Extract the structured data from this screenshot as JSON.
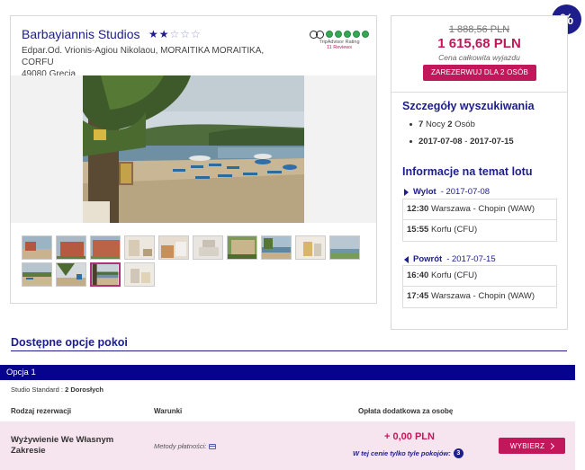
{
  "hotel": {
    "name": "Barbayiannis Studios",
    "stars_full": "★★",
    "stars_empty": "☆☆☆",
    "address_line1": "Edpar.Od. Vrionis-Agiou Nikolaou, MORAITIKA MORAITIKA, CORFU",
    "address_line2": "49080 Grecja",
    "tripadvisor": {
      "label": "TripAdvisor Rating",
      "reviews": "11 Reviews",
      "rating_of_5": 5
    }
  },
  "price": {
    "old": "1 888,56 PLN",
    "new": "1 615,68 PLN",
    "note": "Cena całkowita wyjazdu",
    "book_label": "ZAREZERWUJ DLA 2 OSÓB"
  },
  "badge": "%",
  "search_details": {
    "title": "Szczegóły wyszukiwania",
    "nights": "7",
    "nights_label": "Nocy",
    "persons": "2",
    "persons_label": "Osób",
    "date_from": "2017-07-08",
    "date_sep": "-",
    "date_to": "2017-07-15"
  },
  "flight": {
    "title": "Informacje na temat lotu",
    "outbound": {
      "label": "Wylot",
      "date": "- 2017-07-08",
      "legs": [
        {
          "time": "12:30",
          "place": "Warszawa - Chopin (WAW)"
        },
        {
          "time": "15:55",
          "place": "Korfu (CFU)"
        }
      ]
    },
    "return": {
      "label": "Powrót",
      "date": "- 2017-07-15",
      "legs": [
        {
          "time": "16:40",
          "place": "Korfu (CFU)"
        },
        {
          "time": "17:45",
          "place": "Warszawa - Chopin (WAW)"
        }
      ]
    }
  },
  "rooms": {
    "title": "Dostępne opcje pokoi",
    "option_label": "Opcja 1",
    "room_type": "Studio Standard :",
    "room_guests": "2 Dorosłych",
    "columns": {
      "reservation": "Rodzaj rezerwacji",
      "conditions": "Warunki",
      "extra_fee": "Opłata dodatkowa za osobę"
    },
    "row": {
      "board": "Wyżywienie We Własnym Zakresie",
      "payments": "Metody płatności:",
      "extra_price": "+ 0,00 PLN",
      "rooms_left_label": "W tej cenie tylko tyle pokojów:",
      "rooms_left_count": "3",
      "select_label": "WYBIERZ"
    }
  },
  "colors": {
    "navy": "#1d1d8c",
    "option_bar": "#06038d",
    "accent": "#c2185b",
    "row_bg": "#f6e5ef"
  }
}
